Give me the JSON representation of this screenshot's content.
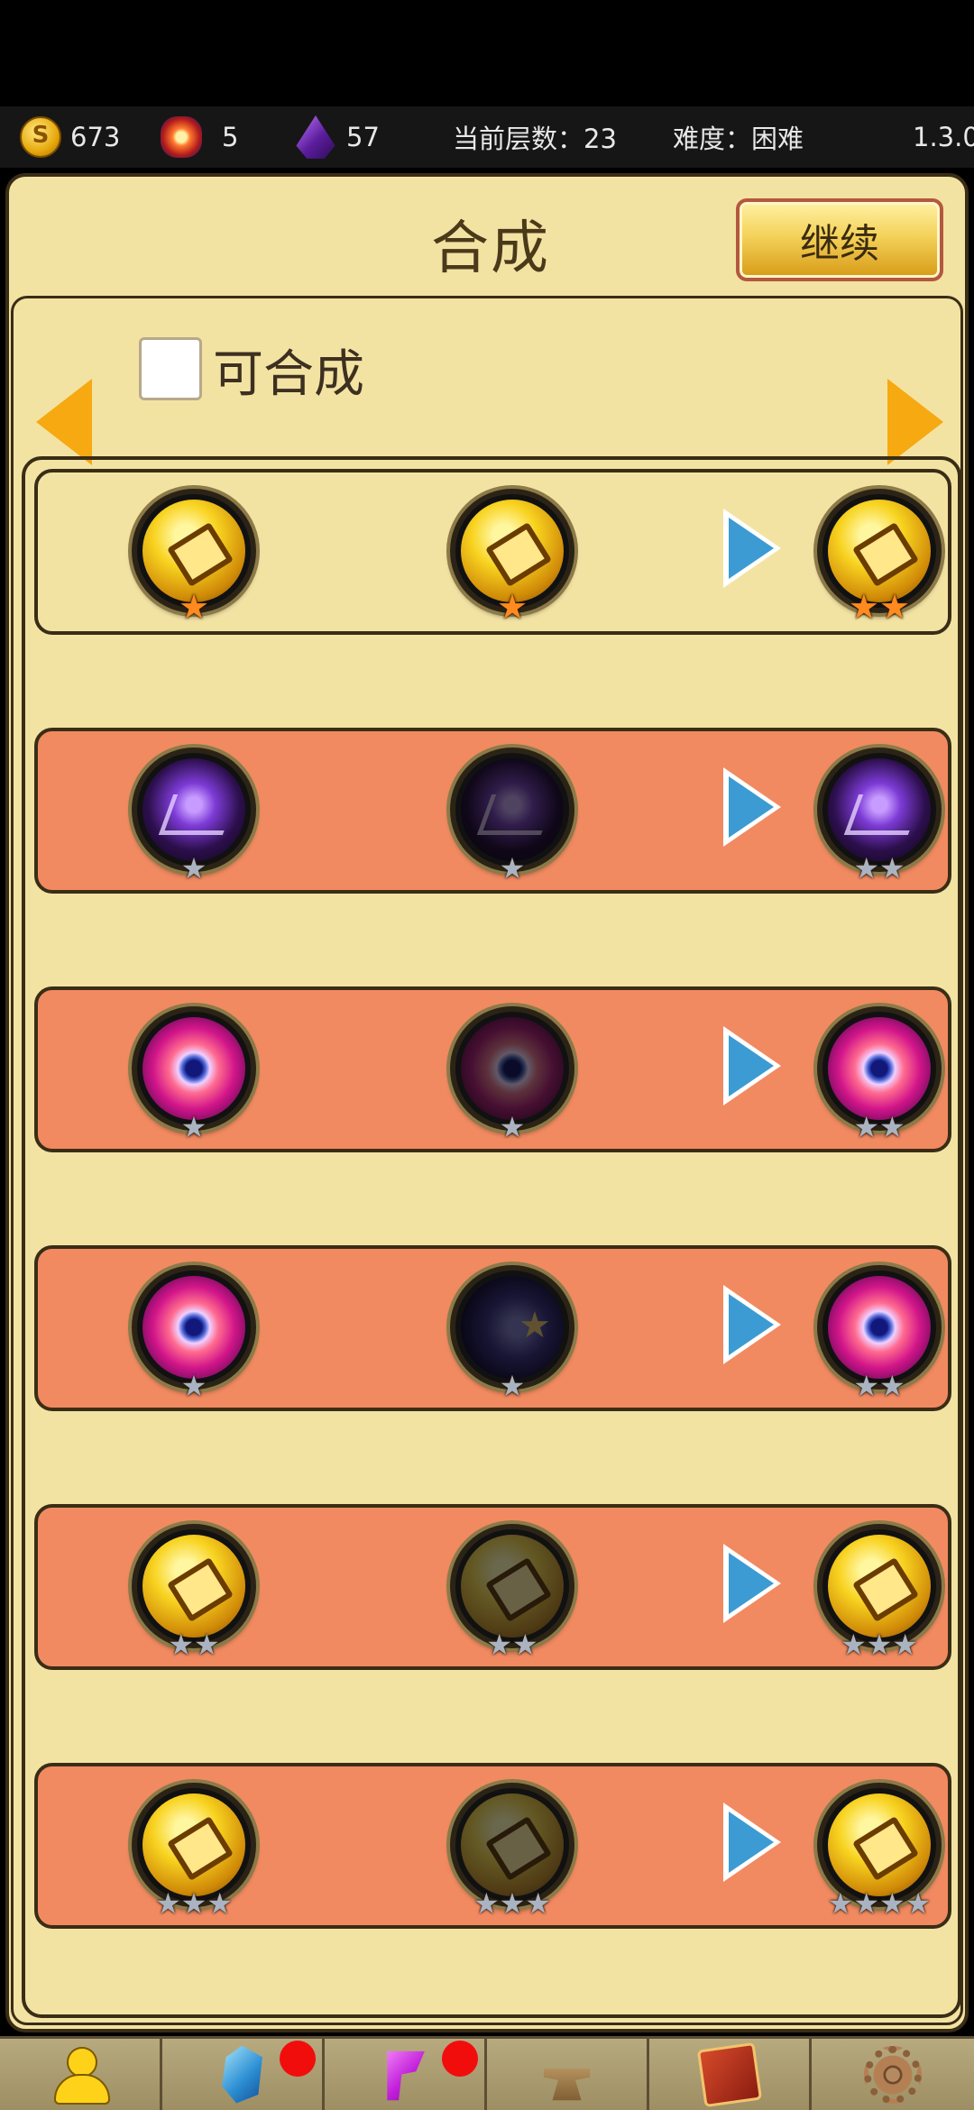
{
  "status_bar": {
    "coins": "673",
    "bombs": "5",
    "crystals": "57",
    "floor_label": "当前层数：23",
    "difficulty_label": "难度：困难",
    "version": "1.3.0"
  },
  "panel": {
    "title": "合成",
    "continue_label": "继续",
    "filter_label": "可合成",
    "filter_checked": false
  },
  "recipes": [
    {
      "state": "ready",
      "item_a": {
        "icon": "gold-coin",
        "stars": 1,
        "star_color": "orange"
      },
      "item_b": {
        "icon": "gold-coin",
        "stars": 1,
        "star_color": "orange",
        "owned": true
      },
      "result": {
        "icon": "gold-coin",
        "stars": 2,
        "star_color": "orange"
      }
    },
    {
      "state": "blocked",
      "item_a": {
        "icon": "shadow-rune",
        "stars": 1,
        "star_color": "silver"
      },
      "item_b": {
        "icon": "shadow-rune",
        "stars": 1,
        "star_color": "silver",
        "owned": false
      },
      "result": {
        "icon": "shadow-rune",
        "stars": 2,
        "star_color": "silver"
      }
    },
    {
      "state": "blocked",
      "item_a": {
        "icon": "magic-eye",
        "stars": 1,
        "star_color": "silver"
      },
      "item_b": {
        "icon": "magic-eye",
        "stars": 1,
        "star_color": "silver",
        "owned": false
      },
      "result": {
        "icon": "magic-eye",
        "stars": 2,
        "star_color": "silver"
      }
    },
    {
      "state": "blocked",
      "item_a": {
        "icon": "magic-eye",
        "stars": 1,
        "star_color": "silver"
      },
      "item_b": {
        "icon": "night-star",
        "stars": 1,
        "star_color": "silver",
        "owned": false
      },
      "result": {
        "icon": "magic-eye",
        "stars": 2,
        "star_color": "silver"
      }
    },
    {
      "state": "blocked",
      "item_a": {
        "icon": "gold-coin",
        "stars": 2,
        "star_color": "silver"
      },
      "item_b": {
        "icon": "gold-coin",
        "stars": 2,
        "star_color": "silver",
        "owned": false
      },
      "result": {
        "icon": "gold-coin",
        "stars": 3,
        "star_color": "silver"
      }
    },
    {
      "state": "blocked",
      "item_a": {
        "icon": "gold-coin",
        "stars": 3,
        "star_color": "silver"
      },
      "item_b": {
        "icon": "gold-coin",
        "stars": 3,
        "star_color": "silver",
        "owned": false
      },
      "result": {
        "icon": "gold-coin",
        "stars": 4,
        "star_color": "silver"
      }
    }
  ],
  "bottom_nav": [
    {
      "icon": "character-icon",
      "badge": false
    },
    {
      "icon": "gem-icon",
      "badge": true
    },
    {
      "icon": "rune-icon",
      "badge": true
    },
    {
      "icon": "anvil-icon",
      "badge": false
    },
    {
      "icon": "book-icon",
      "badge": false
    },
    {
      "icon": "gear-icon",
      "badge": false
    }
  ],
  "colors": {
    "panel_bg": "#f3e3a3",
    "row_ready": "#f3e3a3",
    "row_blocked": "#f18a61",
    "arrow_orange": "#f7a912",
    "play_blue": "#3c9bd3",
    "badge_red": "#f20d0d"
  }
}
